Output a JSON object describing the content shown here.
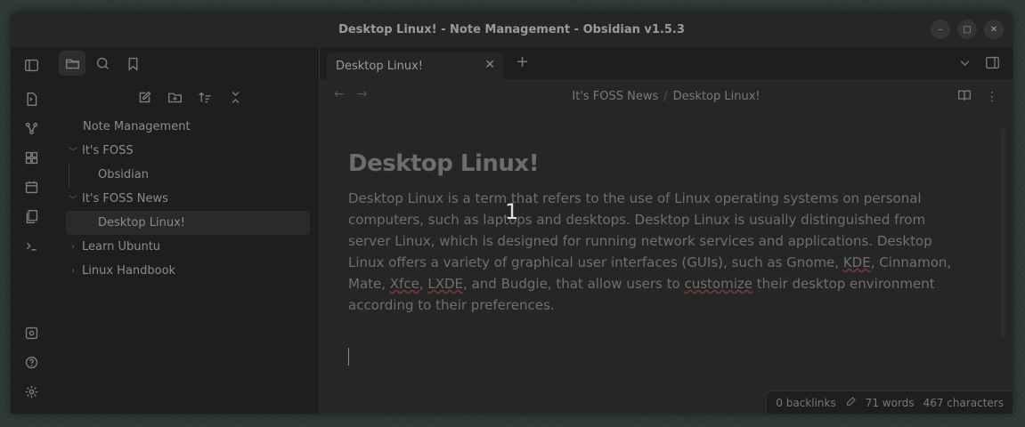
{
  "window": {
    "title": "Desktop Linux! - Note Management - Obsidian v1.5.3",
    "controls": [
      "–",
      "□",
      "✕"
    ]
  },
  "sidebar": {
    "tree": [
      {
        "label": "Note Management",
        "level": 0,
        "folder": false
      },
      {
        "label": "It's FOSS",
        "level": 0,
        "folder": true,
        "expanded": true
      },
      {
        "label": "Obsidian",
        "level": 1,
        "folder": false
      },
      {
        "label": "It's FOSS News",
        "level": 0,
        "folder": true,
        "expanded": true
      },
      {
        "label": "Desktop Linux!",
        "level": 1,
        "folder": false,
        "selected": true
      },
      {
        "label": "Learn Ubuntu",
        "level": 0,
        "folder": true,
        "expanded": false
      },
      {
        "label": "Linux Handbook",
        "level": 0,
        "folder": true,
        "expanded": false
      }
    ]
  },
  "tabs": {
    "active_label": "Desktop Linux!",
    "close": "✕",
    "new_tab": "+"
  },
  "view": {
    "back": "←",
    "forward": "→",
    "breadcrumb_parent": "It's FOSS News",
    "breadcrumb_sep": "/",
    "breadcrumb_current": "Desktop Linux!",
    "more": "⋮"
  },
  "note": {
    "heading": "Desktop Linux!",
    "p1": "Desktop Linux is a term that refers to the use of Linux operating systems on personal computers, such as laptops and desktops. Desktop Linux is usually distinguished from server Linux, which is designed for running network services and applications. Desktop Linux offers a variety of graphical user interfaces (GUIs), such as Gnome, ",
    "kde": "KDE",
    "p2": ", Cinnamon, Mate, ",
    "xfce": "Xfce",
    "p3": ", ",
    "lxde": "LXDE",
    "p4": ", and Budgie, that allow users to ",
    "customize": "customize",
    "p5": " their desktop environment according to their preferences."
  },
  "status": {
    "backlinks": "0 backlinks",
    "words": "71 words",
    "characters": "467 characters"
  },
  "overlay": {
    "number": "1"
  },
  "colors": {
    "background": "#232323",
    "sidebar": "#1e1e1e",
    "editor": "#262626"
  }
}
